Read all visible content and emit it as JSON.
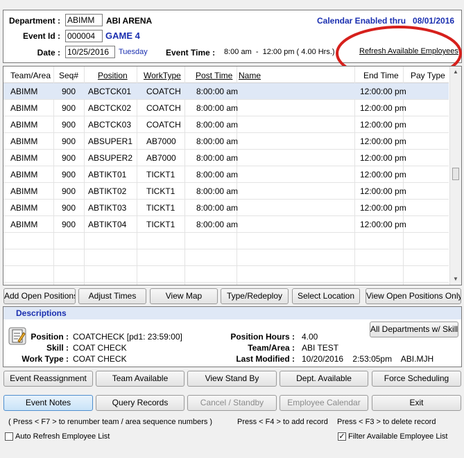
{
  "header": {
    "department_label": "Department :",
    "department_code": "ABIMM",
    "department_name": "ABI ARENA",
    "event_id_label": "Event Id :",
    "event_id": "000004",
    "event_name": "GAME 4",
    "date_label": "Date :",
    "date": "10/25/2016",
    "day": "Tuesday",
    "event_time_label": "Event Time :",
    "event_time": "8:00 am  -  12:00 pm ( 4.00 Hrs.)",
    "calendar_text": "Calendar Enabled thru   08/01/2016",
    "refresh_link": "Refresh Available Employees",
    "highlight_color": "#d6201c"
  },
  "grid": {
    "columns": [
      "Team/Area",
      "Seq#",
      "Position",
      "WorkType",
      "Post Time",
      "Name",
      "End Time",
      "Pay Type"
    ],
    "rows": [
      {
        "team": "ABIMM",
        "seq": "900",
        "position": "ABCTCK01",
        "worktype": "COATCH",
        "post": "8:00:00 am",
        "name": "",
        "end": "12:00:00 pm",
        "pay": ""
      },
      {
        "team": "ABIMM",
        "seq": "900",
        "position": "ABCTCK02",
        "worktype": "COATCH",
        "post": "8:00:00 am",
        "name": "",
        "end": "12:00:00 pm",
        "pay": ""
      },
      {
        "team": "ABIMM",
        "seq": "900",
        "position": "ABCTCK03",
        "worktype": "COATCH",
        "post": "8:00:00 am",
        "name": "",
        "end": "12:00:00 pm",
        "pay": ""
      },
      {
        "team": "ABIMM",
        "seq": "900",
        "position": "ABSUPER1",
        "worktype": "AB7000",
        "post": "8:00:00 am",
        "name": "",
        "end": "12:00:00 pm",
        "pay": ""
      },
      {
        "team": "ABIMM",
        "seq": "900",
        "position": "ABSUPER2",
        "worktype": "AB7000",
        "post": "8:00:00 am",
        "name": "",
        "end": "12:00:00 pm",
        "pay": ""
      },
      {
        "team": "ABIMM",
        "seq": "900",
        "position": "ABTIKT01",
        "worktype": "TICKT1",
        "post": "8:00:00 am",
        "name": "",
        "end": "12:00:00 pm",
        "pay": ""
      },
      {
        "team": "ABIMM",
        "seq": "900",
        "position": "ABTIKT02",
        "worktype": "TICKT1",
        "post": "8:00:00 am",
        "name": "",
        "end": "12:00:00 pm",
        "pay": ""
      },
      {
        "team": "ABIMM",
        "seq": "900",
        "position": "ABTIKT03",
        "worktype": "TICKT1",
        "post": "8:00:00 am",
        "name": "",
        "end": "12:00:00 pm",
        "pay": ""
      },
      {
        "team": "ABIMM",
        "seq": "900",
        "position": "ABTIKT04",
        "worktype": "TICKT1",
        "post": "8:00:00 am",
        "name": "",
        "end": "12:00:00 pm",
        "pay": ""
      }
    ]
  },
  "toolbar1": {
    "add_open_positions": "Add Open Positions",
    "adjust_times": "Adjust Times",
    "view_map": "View Map",
    "type_redeploy": "Type/Redeploy",
    "select_location": "Select Location",
    "view_open_positions_only": "View Open Positions Only"
  },
  "descriptions": {
    "title": "Descriptions",
    "all_departments_button": "All Departments w/ Skill",
    "position_label": "Position :",
    "position_value": "COATCHECK  [pd1: 23:59:00]",
    "skill_label": "Skill :",
    "skill_value": "COAT CHECK",
    "work_type_label": "Work Type :",
    "work_type_value": "COAT CHECK",
    "position_hours_label": "Position Hours :",
    "position_hours_value": "4.00",
    "team_area_label": "Team/Area :",
    "team_area_value": "ABI TEST",
    "last_modified_label": "Last Modified :",
    "last_modified_value": "10/20/2016    2:53:05pm    ABI.MJH"
  },
  "toolbar2": {
    "event_reassignment": "Event Reassignment",
    "team_available": "Team Available",
    "view_stand_by": "View Stand By",
    "dept_available": "Dept. Available",
    "force_scheduling": "Force Scheduling"
  },
  "toolbar3": {
    "event_notes": "Event Notes",
    "query_records": "Query Records",
    "cancel_standby": "Cancel / Standby",
    "employee_calendar": "Employee Calendar",
    "exit": "Exit"
  },
  "hints": {
    "f7": "( Press  < F7 >  to renumber team / area sequence numbers )",
    "f4": "Press  < F4 >  to add record",
    "f3": "Press  < F3 >  to delete record"
  },
  "options": {
    "auto_refresh_label": "Auto Refresh Employee List",
    "auto_refresh_checked": false,
    "filter_label": "Filter Available Employee List",
    "filter_checked": true
  },
  "icons": {
    "notes": "notes-edit-icon",
    "scroll_up": "scroll-up-arrow-icon",
    "scroll_down": "scroll-down-arrow-icon"
  }
}
